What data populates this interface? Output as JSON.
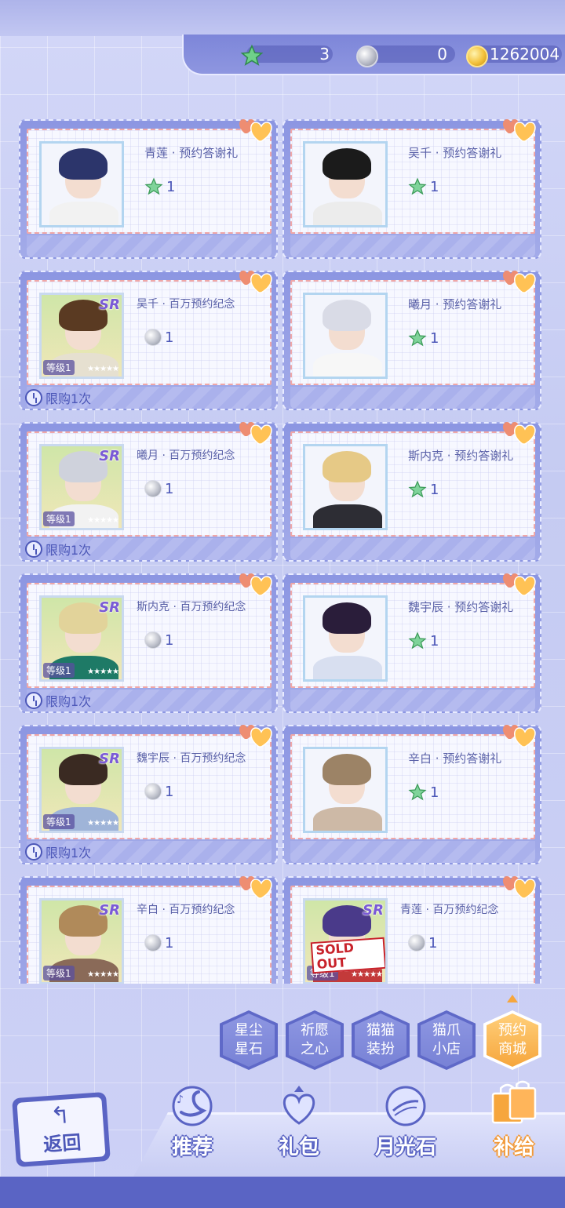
{
  "currency": {
    "star_amount": "3",
    "silver_amount": "0",
    "gold_amount": "1262004",
    "star_icon": "green-star-icon",
    "silver_icon": "silver-coin-icon",
    "gold_icon": "gold-coin-icon"
  },
  "items": [
    {
      "title": "青莲 · 预约答谢礼",
      "price": "1",
      "currency": "star",
      "sr": false,
      "limit": "",
      "sold_out": false,
      "hair": "#2c356b",
      "body": "#f2f2f2"
    },
    {
      "title": "吴千 · 预约答谢礼",
      "price": "1",
      "currency": "star",
      "sr": false,
      "limit": "",
      "sold_out": false,
      "hair": "#1b1b1b",
      "body": "#ececec"
    },
    {
      "title": "吴千 · 百万预约纪念",
      "price": "1",
      "currency": "silver",
      "sr": true,
      "level": "等级1",
      "limit": "限购1次",
      "sold_out": false,
      "hair": "#5a3a22",
      "body": "#e6e0d0"
    },
    {
      "title": "曦月 · 预约答谢礼",
      "price": "1",
      "currency": "star",
      "sr": false,
      "limit": "",
      "sold_out": false,
      "hair": "#d9dbe6",
      "body": "#f7f7f7"
    },
    {
      "title": "曦月 · 百万预约纪念",
      "price": "1",
      "currency": "silver",
      "sr": true,
      "level": "等级1",
      "limit": "限购1次",
      "sold_out": false,
      "hair": "#cfd2dc",
      "body": "#f2f2f2"
    },
    {
      "title": "斯内克 · 预约答谢礼",
      "price": "1",
      "currency": "star",
      "sr": false,
      "limit": "",
      "sold_out": false,
      "hair": "#e6c986",
      "body": "#2d2d34"
    },
    {
      "title": "斯内克 · 百万预约纪念",
      "price": "1",
      "currency": "silver",
      "sr": true,
      "level": "等级1",
      "limit": "限购1次",
      "sold_out": false,
      "hair": "#e2d39a",
      "body": "#1e7a66"
    },
    {
      "title": "魏宇辰 · 预约答谢礼",
      "price": "1",
      "currency": "star",
      "sr": false,
      "limit": "",
      "sold_out": false,
      "hair": "#2a1d3a",
      "body": "#d8dff0"
    },
    {
      "title": "魏宇辰 · 百万预约纪念",
      "price": "1",
      "currency": "silver",
      "sr": true,
      "level": "等级1",
      "limit": "限购1次",
      "sold_out": false,
      "hair": "#3a2a22",
      "body": "#9fb4d8"
    },
    {
      "title": "辛白 · 预约答谢礼",
      "price": "1",
      "currency": "star",
      "sr": false,
      "limit": "",
      "sold_out": false,
      "hair": "#9c8366",
      "body": "#cdb9a6"
    },
    {
      "title": "辛白 · 百万预约纪念",
      "price": "1",
      "currency": "silver",
      "sr": true,
      "level": "等级1",
      "limit": "",
      "sold_out": false,
      "hair": "#b08a5a",
      "body": "#8a6a58"
    },
    {
      "title": "青莲 · 百万预约纪念",
      "price": "1",
      "currency": "silver",
      "sr": true,
      "level": "等级1",
      "limit": "",
      "sold_out": true,
      "sold_text": "SOLD OUT",
      "hair": "#4a3a8a",
      "body": "#c33a3a"
    }
  ],
  "shop_tabs": [
    {
      "label": "星尘星石",
      "line1": "星尘",
      "line2": "星石"
    },
    {
      "label": "祈愿之心",
      "line1": "祈愿",
      "line2": "之心"
    },
    {
      "label": "猫猫装扮",
      "line1": "猫猫",
      "line2": "装扮"
    },
    {
      "label": "猫爪小店",
      "line1": "猫爪",
      "line2": "小店"
    },
    {
      "label": "预约商城",
      "line1": "预约",
      "line2": "商城"
    }
  ],
  "bottom_tabs": [
    {
      "label": "推荐",
      "icon": "swan-icon"
    },
    {
      "label": "礼包",
      "icon": "gift-heart-icon"
    },
    {
      "label": "月光石",
      "icon": "moonstone-icon"
    },
    {
      "label": "补给",
      "icon": "shopping-bag-icon"
    }
  ],
  "back": {
    "label": "返回",
    "icon": "back-arrow-icon"
  },
  "colors": {
    "accent": "#5a64c4",
    "active": "#f6a63d",
    "panel": "#8c96e2"
  }
}
